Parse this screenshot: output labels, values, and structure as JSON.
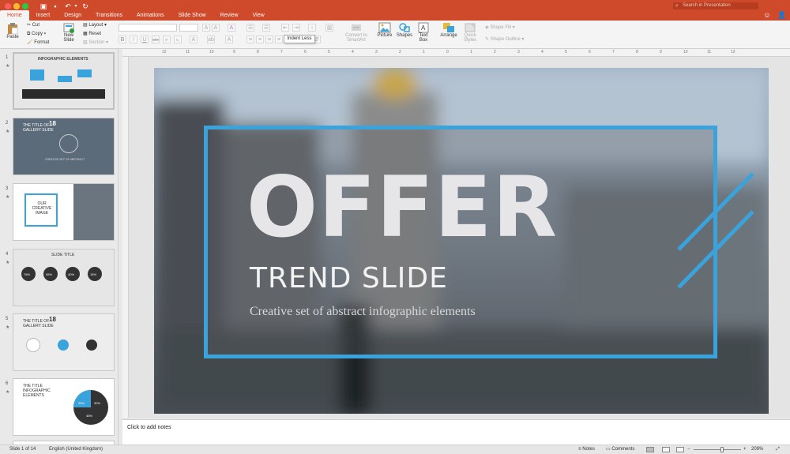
{
  "tabs": [
    "Home",
    "Insert",
    "Design",
    "Transitions",
    "Animations",
    "Slide Show",
    "Review",
    "View"
  ],
  "search": {
    "placeholder": "Search in Presentation"
  },
  "ribbon": {
    "paste": "Paste",
    "cut": "Cut",
    "copy": "Copy",
    "format": "Format",
    "new_slide": "New Slide",
    "layout": "Layout",
    "reset": "Reset",
    "section": "Section",
    "convert": "Convert to SmartArt",
    "picture": "Picture",
    "shapes": "Shapes",
    "text_box": "Text Box",
    "arrange": "Arrange",
    "quick_styles": "Quick Styles",
    "shape_fill": "Shape Fill",
    "shape_outline": "Shape Outline",
    "tooltip": "Indent Less"
  },
  "thumbnails": [
    {
      "number": "1",
      "title": "INFOGRAPHIC ELEMENTS"
    },
    {
      "number": "2",
      "title": "THE TITLE OF GALLERY SLIDE",
      "big": "18",
      "caption": "CREATIVE SET OF ABSTRACT"
    },
    {
      "number": "3",
      "title": "OUR CREATIVE IMAGE"
    },
    {
      "number": "4",
      "title": "SLIDE TITLE",
      "values": [
        "78%",
        "55%",
        "40%",
        "15%"
      ]
    },
    {
      "number": "5",
      "title": "THE TITLE OF GALLERY SLIDE",
      "big": "18"
    },
    {
      "number": "6",
      "title": "THE TITLE INFOGRAPHIC ELEMENTS",
      "values": [
        "25%",
        "30%",
        "45%"
      ]
    }
  ],
  "ruler": {
    "h_ticks": [
      "12",
      "11",
      "10",
      "9",
      "8",
      "7",
      "6",
      "5",
      "4",
      "3",
      "2",
      "1",
      "0",
      "1",
      "2",
      "3",
      "4",
      "5",
      "6",
      "7",
      "8",
      "9",
      "10",
      "11",
      "12"
    ]
  },
  "slide": {
    "headline": "OFFER",
    "subheadline": "TREND SLIDE",
    "tagline": "Creative set of abstract infographic elements"
  },
  "colors": {
    "accent": "#3aa3dc",
    "brand": "#cf4a2a"
  },
  "notes": {
    "placeholder": "Click to add notes"
  },
  "status": {
    "slide_position": "Slide 1 of 14",
    "language": "English (United Kingdom)",
    "notes": "Notes",
    "comments": "Comments",
    "zoom": "209%"
  }
}
